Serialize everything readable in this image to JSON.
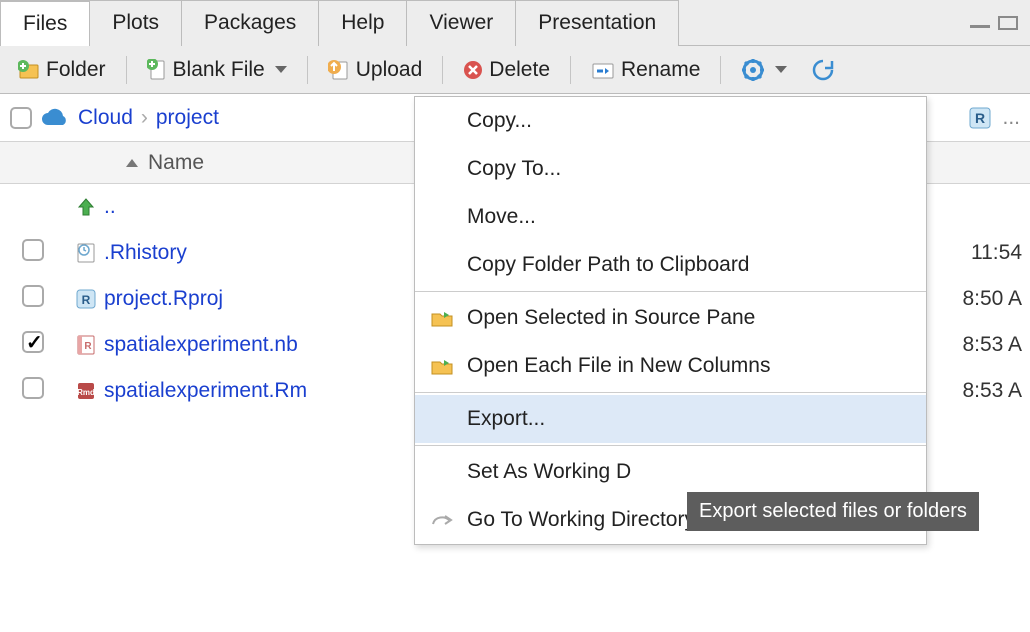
{
  "tabs": [
    "Files",
    "Plots",
    "Packages",
    "Help",
    "Viewer",
    "Presentation"
  ],
  "active_tab": 0,
  "toolbar": {
    "folder": "Folder",
    "blank_file": "Blank File",
    "upload": "Upload",
    "delete": "Delete",
    "rename": "Rename"
  },
  "breadcrumb": {
    "root": "Cloud",
    "path": "project",
    "more": "..."
  },
  "columns": {
    "name": "Name"
  },
  "files": [
    {
      "up": true,
      "name": "..",
      "checked": false,
      "icon": "up-arrow-icon",
      "time": ""
    },
    {
      "name": ".Rhistory",
      "checked": false,
      "icon": "rhistory-icon",
      "time": "11:54"
    },
    {
      "name": "project.Rproj",
      "checked": false,
      "icon": "rproj-icon",
      "time": "8:50 A"
    },
    {
      "name": "spatialexperiment.nb",
      "checked": true,
      "icon": "rnotebook-icon",
      "time": "8:53 A"
    },
    {
      "name": "spatialexperiment.Rm",
      "checked": false,
      "icon": "rmd-icon",
      "time": "8:53 A"
    }
  ],
  "menu": [
    {
      "label": "Copy...",
      "icon": ""
    },
    {
      "label": "Copy To...",
      "icon": ""
    },
    {
      "label": "Move...",
      "icon": ""
    },
    {
      "label": "Copy Folder Path to Clipboard",
      "icon": ""
    },
    {
      "sep": true
    },
    {
      "label": "Open Selected in Source Pane",
      "icon": "folder-open-icon"
    },
    {
      "label": "Open Each File in New Columns",
      "icon": "folder-open-icon"
    },
    {
      "sep": true
    },
    {
      "label": "Export...",
      "icon": "",
      "highlight": true
    },
    {
      "sep": true
    },
    {
      "label": "Set As Working D",
      "icon": ""
    },
    {
      "label": "Go To Working Directory",
      "icon": "goto-arrow-icon"
    }
  ],
  "tooltip": "Export selected files or folders"
}
